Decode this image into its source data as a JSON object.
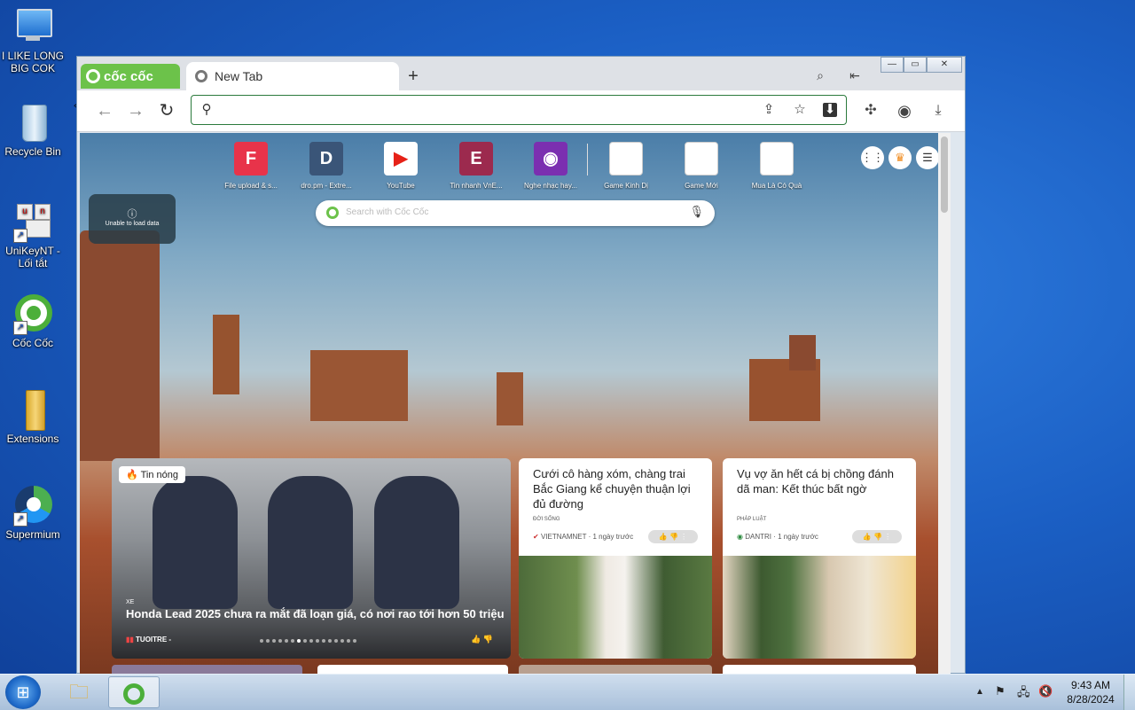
{
  "desktop": {
    "icons": [
      {
        "label": "I LIKE LONG BIG COK",
        "icon": "computer-icon"
      },
      {
        "label": "Recycle Bin",
        "icon": "recycle-bin-icon"
      },
      {
        "label": "UniKeyNT - Lối tắt",
        "icon": "unikey-icon"
      },
      {
        "label": "Cốc Cốc",
        "icon": "coccoc-icon"
      },
      {
        "label": "Extensions",
        "icon": "folder-icon"
      },
      {
        "label": "Supermium",
        "icon": "supermium-icon"
      }
    ]
  },
  "browser": {
    "brand": "cốc cốc",
    "tab_title": "New Tab",
    "new_tab": "+",
    "omnibox_value": "",
    "quick_links": [
      {
        "label": "File upload & s...",
        "letter": "F",
        "color": "#e8334a"
      },
      {
        "label": "dro.pm - Extre...",
        "letter": "D",
        "color": "#3a5578"
      },
      {
        "label": "YouTube",
        "letter": "▶",
        "color": "#ffffff"
      },
      {
        "label": "Tin nhanh VnE...",
        "letter": "E",
        "color": "#9c2a4e"
      },
      {
        "label": "Nghe nhạc hay...",
        "letter": "◉",
        "color": "#7b2fb0"
      },
      {
        "label": "Game Kinh Dị",
        "letter": "",
        "color": "#ffffff"
      },
      {
        "label": "Game Mới",
        "letter": "",
        "color": "#ffffff"
      },
      {
        "label": "Mua Là Có Quà",
        "letter": "",
        "color": "#ffffff"
      }
    ],
    "error_text": "Unable to load data",
    "search_placeholder": "Search with Cốc Cốc",
    "news": {
      "featured": {
        "badge": "Tin nóng",
        "category": "XE",
        "headline": "Honda Lead 2025 chưa ra mắt đã loạn giá, có nơi rao tới hơn 50 triệu",
        "source": "TUOITRE -"
      },
      "cards": [
        {
          "title": "Cưới cô hàng xóm, chàng trai Bắc Giang kể chuyện thuận lợi đủ đường",
          "category": "ĐỜI SỐNG",
          "source": "VIETNAMNET · 1 ngày trước"
        },
        {
          "title": "Vụ vợ ăn hết cá bị chồng đánh dã man: Kết thúc bất ngờ",
          "category": "PHÁP LUẬT",
          "source": "DANTRI · 1 ngày trước"
        }
      ]
    }
  },
  "taskbar": {
    "time": "9:43 AM",
    "date": "8/28/2024"
  }
}
